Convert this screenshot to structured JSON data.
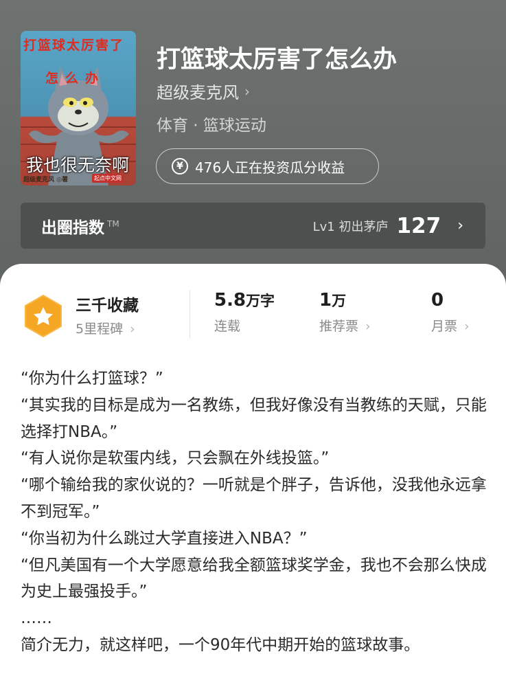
{
  "cover": {
    "title": "打篮球太厉害了",
    "subtitle": "怎么办",
    "caption": "我也很无奈啊",
    "author": "超级麦克风 ◎著",
    "publisher": "起点中文网"
  },
  "book": {
    "title": "打篮球太厉害了怎么办",
    "author": "超级麦克风",
    "category": "体育 · 篮球运动",
    "invest_text": "476人正在投资瓜分收益"
  },
  "circle_index": {
    "label": "出圈指数",
    "tm": "TM",
    "level": "Lv1 初出茅庐",
    "score": "127"
  },
  "stats": {
    "collection_title": "三千收藏",
    "collection_sub": "5里程碑",
    "words_value": "5.8",
    "words_unit": "万字",
    "words_label": "连载",
    "recommend_value": "1",
    "recommend_unit": "万",
    "recommend_label": "推荐票",
    "monthly_value": "0",
    "monthly_label": "月票"
  },
  "synopsis": [
    "“你为什么打篮球？”",
    "“其实我的目标是成为一名教练，但我好像没有当教练的天赋，只能选择打NBA。”",
    "“有人说你是软蛋内线，只会飘在外线投篮。”",
    "“哪个输给我的家伙说的？一听就是个胖子，告诉他，没我他永远拿不到冠军。”",
    "“你当初为什么跳过大学直接进入NBA？”",
    "“但凡美国有一个大学愿意给我全额篮球奖学金，我也不会那么快成为史上最强投手。”",
    "……",
    "简介无力，就这样吧，一个90年代中期开始的篮球故事。"
  ],
  "icons": {
    "chevron": "›",
    "yen": "¥"
  },
  "colors": {
    "header_bg": "#6e7270",
    "badge": "#f5a623",
    "card_bg": "#ffffff"
  }
}
